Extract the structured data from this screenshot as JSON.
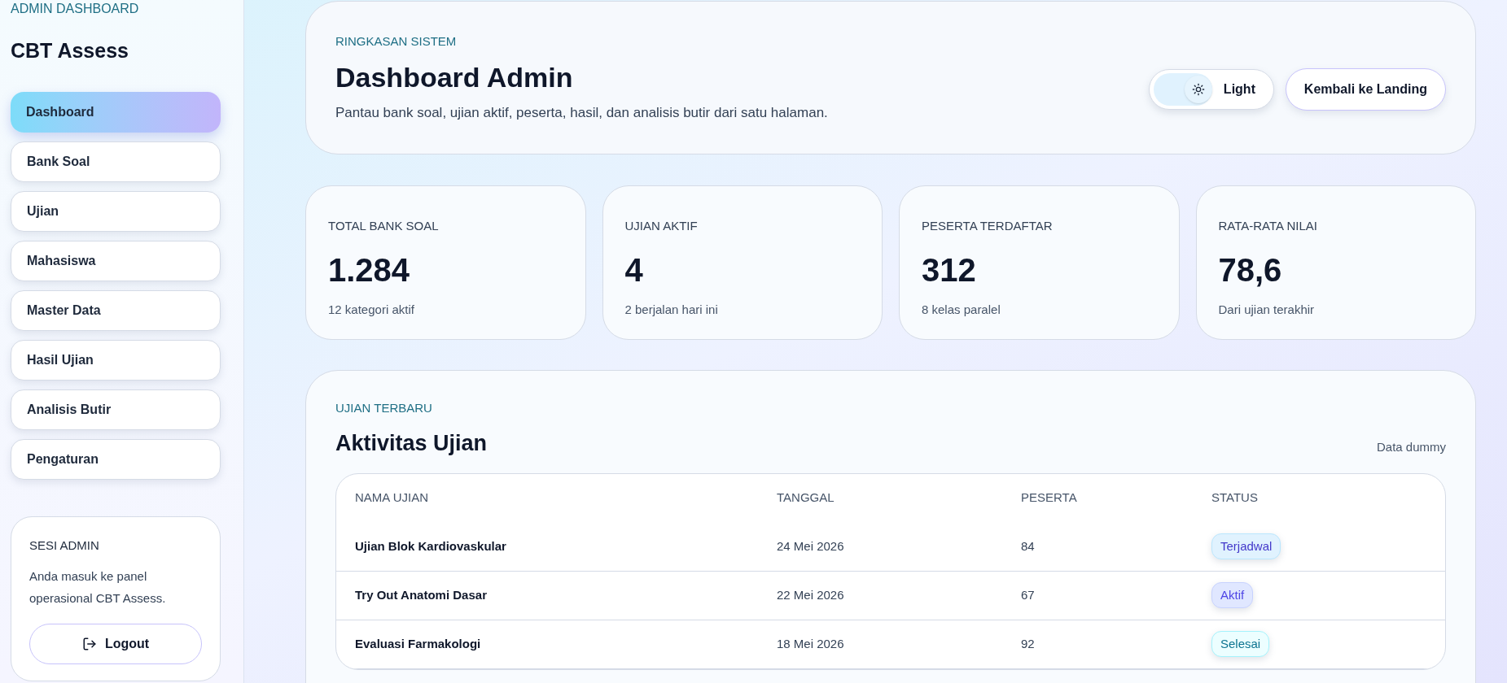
{
  "sidebar": {
    "eyebrow": "ADMIN DASHBOARD",
    "brand": "CBT Assess",
    "items": [
      {
        "label": "Dashboard",
        "selected": true
      },
      {
        "label": "Bank Soal",
        "selected": false
      },
      {
        "label": "Ujian",
        "selected": false
      },
      {
        "label": "Mahasiswa",
        "selected": false
      },
      {
        "label": "Master Data",
        "selected": false
      },
      {
        "label": "Hasil Ujian",
        "selected": false
      },
      {
        "label": "Analisis Butir",
        "selected": false
      },
      {
        "label": "Pengaturan",
        "selected": false
      }
    ],
    "session": {
      "title": "SESI ADMIN",
      "text": "Anda masuk ke panel operasional CBT Assess.",
      "button": "Logout"
    }
  },
  "header": {
    "eyebrow": "RINGKASAN SISTEM",
    "title": "Dashboard Admin",
    "subtitle": "Pantau bank soal, ujian aktif, peserta, hasil, dan analisis butir dari satu halaman.",
    "theme_toggle": {
      "label": "Light",
      "light": true
    },
    "button": "Kembali ke Landing"
  },
  "stats": [
    {
      "label": "TOTAL BANK SOAL",
      "value": "1.284",
      "note": "12 kategori aktif"
    },
    {
      "label": "UJIAN AKTIF",
      "value": "4",
      "note": "2 berjalan hari ini"
    },
    {
      "label": "PESERTA TERDAFTAR",
      "value": "312",
      "note": "8 kelas paralel"
    },
    {
      "label": "RATA-RATA NILAI",
      "value": "78,6",
      "note": "Dari ujian terakhir"
    }
  ],
  "activity": {
    "eyebrow": "UJIAN TERBARU",
    "title": "Aktivitas Ujian",
    "note": "Data dummy",
    "table": {
      "columns": [
        "NAMA UJIAN",
        "TANGGAL",
        "PESERTA",
        "STATUS"
      ],
      "rows": [
        {
          "name": "Ujian Blok Kardiovaskular",
          "date": "24 Mei 2026",
          "participants": "84",
          "status": {
            "label": "Terjadwal",
            "kind": "scheduled"
          }
        },
        {
          "name": "Try Out Anatomi Dasar",
          "date": "22 Mei 2026",
          "participants": "67",
          "status": {
            "label": "Aktif",
            "kind": "active"
          }
        },
        {
          "name": "Evaluasi Farmakologi",
          "date": "18 Mei 2026",
          "participants": "92",
          "status": {
            "label": "Selesai",
            "kind": "done"
          }
        }
      ]
    }
  }
}
